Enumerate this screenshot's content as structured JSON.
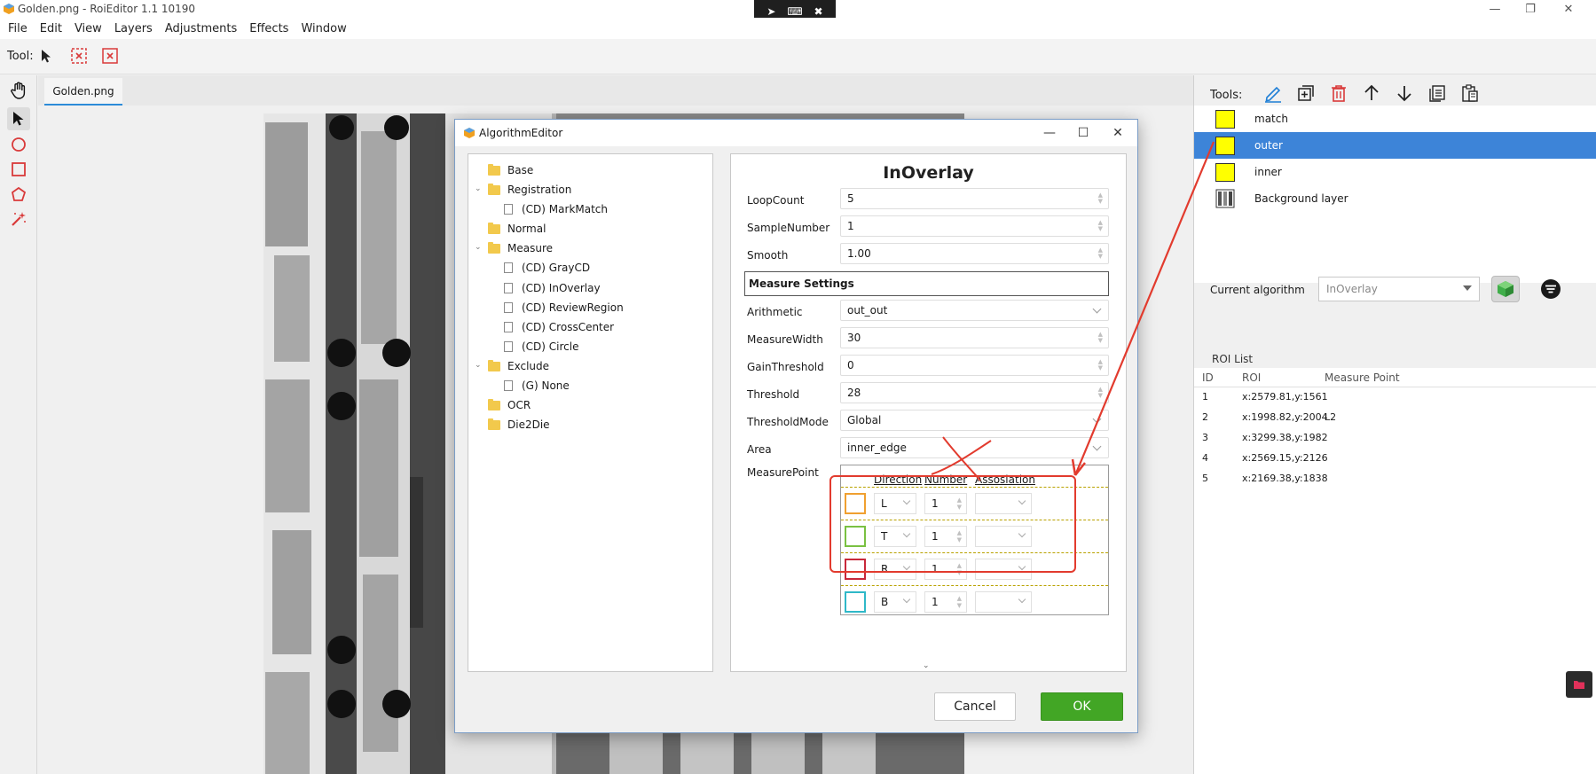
{
  "window": {
    "title": "Golden.png - RoiEditor 1.1 10190",
    "minimize": "—",
    "maximize": "❐",
    "close": "✕"
  },
  "remote_bar": {
    "icons": [
      "pointer-icon",
      "keyboard-icon",
      "close-circle-icon"
    ]
  },
  "menu": [
    "File",
    "Edit",
    "View",
    "Layers",
    "Adjustments",
    "Effects",
    "Window"
  ],
  "toolbar": {
    "tool_label": "Tool:"
  },
  "left_tools": [
    "hand-icon",
    "select-arrow-icon",
    "circle-icon",
    "rectangle-icon",
    "polygon-icon",
    "magic-wand-icon"
  ],
  "document": {
    "tab": "Golden.png"
  },
  "right_panel": {
    "tools_label": "Tools:",
    "tool_icons": [
      "pen-edit-icon",
      "add-layer-icon",
      "delete-icon",
      "arrow-up-icon",
      "arrow-down-icon",
      "copy-icon",
      "paste-icon"
    ],
    "layers": [
      {
        "name": "match",
        "swatch": "#ffff00"
      },
      {
        "name": "outer",
        "swatch": "#ffff00",
        "selected": true
      },
      {
        "name": "inner",
        "swatch": "#ffff00"
      },
      {
        "name": "Background layer",
        "swatch": ""
      }
    ],
    "current_algorithm_label": "Current algorithm",
    "current_algorithm_value": "InOverlay",
    "roi_list_label": "ROI List",
    "roi_columns": [
      "ID",
      "ROI",
      "Measure Point"
    ],
    "roi_rows": [
      {
        "id": "1",
        "roi": "x:2579.81,y:1561",
        "mp": ""
      },
      {
        "id": "2",
        "roi": "x:1998.82,y:2004",
        "mp": "L2"
      },
      {
        "id": "3",
        "roi": "x:3299.38,y:1982",
        "mp": ""
      },
      {
        "id": "4",
        "roi": "x:2569.15,y:2126",
        "mp": ""
      },
      {
        "id": "5",
        "roi": "x:2169.38,y:1838",
        "mp": ""
      }
    ]
  },
  "dialog": {
    "title": "AlgorithmEditor",
    "tree": [
      {
        "label": "Base",
        "type": "folder",
        "level": 0
      },
      {
        "label": "Registration",
        "type": "folder",
        "level": 0,
        "expanded": true
      },
      {
        "label": "(CD) MarkMatch",
        "type": "file",
        "level": 1
      },
      {
        "label": "Normal",
        "type": "folder",
        "level": 0
      },
      {
        "label": "Measure",
        "type": "folder",
        "level": 0,
        "expanded": true
      },
      {
        "label": "(CD) GrayCD",
        "type": "file",
        "level": 1
      },
      {
        "label": "(CD) InOverlay",
        "type": "file",
        "level": 1
      },
      {
        "label": "(CD) ReviewRegion",
        "type": "file",
        "level": 1
      },
      {
        "label": "(CD) CrossCenter",
        "type": "file",
        "level": 1
      },
      {
        "label": "(CD) Circle",
        "type": "file",
        "level": 1
      },
      {
        "label": "Exclude",
        "type": "folder",
        "level": 0,
        "expanded": true
      },
      {
        "label": "(G) None",
        "type": "file",
        "level": 1
      },
      {
        "label": "OCR",
        "type": "folder",
        "level": 0
      },
      {
        "label": "Die2Die",
        "type": "folder",
        "level": 0
      }
    ],
    "props_title": "InOverlay",
    "fields": [
      {
        "label": "LoopCount",
        "value": "5",
        "kind": "spin"
      },
      {
        "label": "SampleNumber",
        "value": "1",
        "kind": "spin"
      },
      {
        "label": "Smooth",
        "value": "1.00",
        "kind": "spin"
      }
    ],
    "section": "Measure Settings",
    "measure_fields": [
      {
        "label": "Arithmetic",
        "value": "out_out",
        "kind": "dropdown"
      },
      {
        "label": "MeasureWidth",
        "value": "30",
        "kind": "spin"
      },
      {
        "label": "GainThreshold",
        "value": "0",
        "kind": "spin"
      },
      {
        "label": "Threshold",
        "value": "28",
        "kind": "spin"
      },
      {
        "label": "ThresholdMode",
        "value": "Global",
        "kind": "dropdown"
      },
      {
        "label": "Area",
        "value": "inner_edge",
        "kind": "dropdown"
      }
    ],
    "measure_point_label": "MeasurePoint",
    "mp_columns": [
      "Direction",
      "Number",
      "Assosiation"
    ],
    "mp_rows": [
      {
        "color": "#f0a030",
        "direction": "L",
        "number": "1",
        "assoc": ""
      },
      {
        "color": "#7ac142",
        "direction": "T",
        "number": "1",
        "assoc": ""
      },
      {
        "color": "#c8283a",
        "direction": "R",
        "number": "1",
        "assoc": ""
      },
      {
        "color": "#2fb8c8",
        "direction": "B",
        "number": "1",
        "assoc": ""
      }
    ],
    "cancel": "Cancel",
    "ok": "OK"
  },
  "colors": {
    "selection": "#3d84d8",
    "ok_green": "#42a625",
    "annotation_red": "#e23b2e",
    "icon_blue": "#1f7fd6",
    "icon_red": "#d93a3a"
  }
}
